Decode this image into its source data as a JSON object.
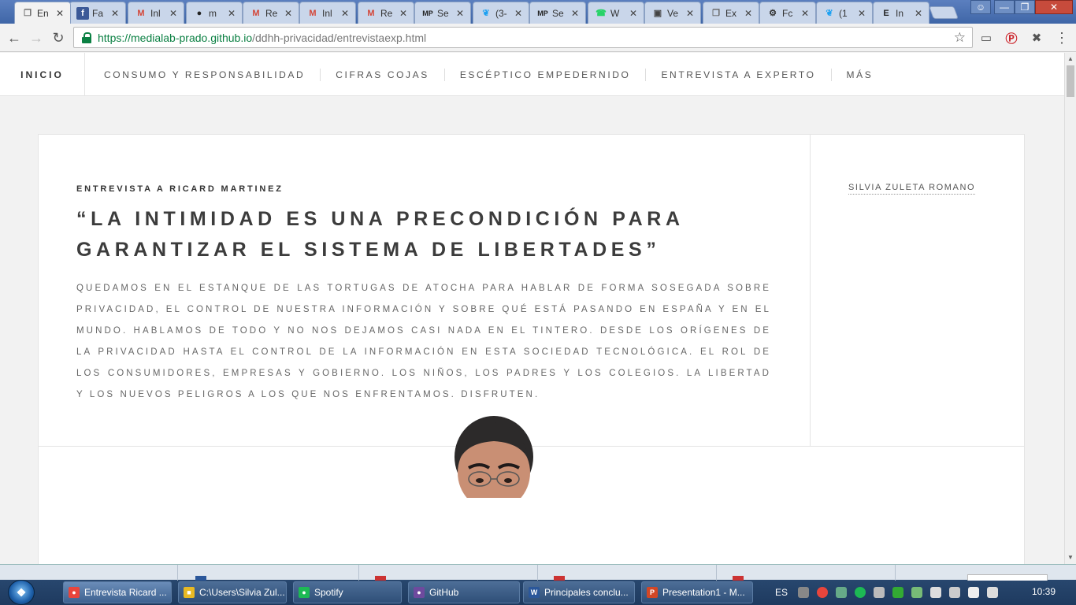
{
  "browser": {
    "tabs": [
      {
        "label": "En",
        "icon": "doc",
        "color": "#666",
        "active": true
      },
      {
        "label": "Fa",
        "icon": "f",
        "color": "#3b5998"
      },
      {
        "label": "Inl",
        "icon": "M",
        "color": "#d44638"
      },
      {
        "label": "m",
        "icon": "gh",
        "color": "#222"
      },
      {
        "label": "Re",
        "icon": "M",
        "color": "#d44638"
      },
      {
        "label": "Inl",
        "icon": "M",
        "color": "#d44638"
      },
      {
        "label": "Re",
        "icon": "M",
        "color": "#d44638"
      },
      {
        "label": "Se",
        "icon": "MP",
        "color": "#222"
      },
      {
        "label": "(3-",
        "icon": "tw",
        "color": "#1da1f2"
      },
      {
        "label": "Se",
        "icon": "MP",
        "color": "#222"
      },
      {
        "label": "W",
        "icon": "wa",
        "color": "#25d366"
      },
      {
        "label": "Ve",
        "icon": "vi",
        "color": "#444"
      },
      {
        "label": "Ex",
        "icon": "doc",
        "color": "#666"
      },
      {
        "label": "Fc",
        "icon": "gear",
        "color": "#333"
      },
      {
        "label": "(1",
        "icon": "tw",
        "color": "#1da1f2"
      },
      {
        "label": "In",
        "icon": "E",
        "color": "#222"
      }
    ],
    "url_host": "https://medialab-prado.github.io",
    "url_path": "/ddhh-privacidad/entrevistaexp.html"
  },
  "site": {
    "brand": "INICIO",
    "nav": [
      "CONSUMO Y RESPONSABILIDAD",
      "CIFRAS COJAS",
      "ESCÉPTICO EMPEDERNIDO",
      "ENTREVISTA A EXPERTO",
      "MÁS"
    ]
  },
  "article": {
    "kicker": "ENTREVISTA A RICARD MARTINEZ",
    "headline": "“LA INTIMIDAD ES UNA PRECONDICIÓN PARA GARANTIZAR EL SISTEMA DE LIBERTADES”",
    "lead": "QUEDAMOS EN EL ESTANQUE DE LAS TORTUGAS DE ATOCHA PARA HABLAR DE FORMA SOSEGADA SOBRE PRIVACIDAD, EL CONTROL DE NUESTRA INFORMACIÓN Y SOBRE QUÉ ESTÁ PASANDO EN ESPAÑA Y EN EL MUNDO. HABLAMOS DE TODO Y NO NOS DEJAMOS CASI NADA EN EL TINTERO. DESDE LOS ORÍGENES DE LA PRIVACIDAD HASTA EL CONTROL DE LA INFORMACIÓN EN ESTA SOCIEDAD TECNOLÓGICA. EL ROL DE LOS CONSUMIDORES, EMPRESAS Y GOBIERNO. LOS NIÑOS, LOS PADRES Y LOS COLEGIOS. LA LIBERTAD Y LOS NUEVOS PELIGROS A LOS QUE NOS ENFRENTAMOS. DISFRUTEN.",
    "author": "SILVIA ZULETA ROMANO"
  },
  "taskbar": {
    "buttons": [
      {
        "label": "Entrevista Ricard ...",
        "icon": "chrome",
        "color": "#e8453c"
      },
      {
        "label": "C:\\Users\\Silvia Zul...",
        "icon": "folder",
        "color": "#e8b923"
      },
      {
        "label": "Spotify",
        "icon": "spotify",
        "color": "#1db954"
      },
      {
        "label": "GitHub",
        "icon": "github",
        "color": "#6e4a9e"
      },
      {
        "label": "Principales conclu...",
        "icon": "word",
        "color": "#2b579a"
      },
      {
        "label": "Presentation1 - M...",
        "icon": "powerpoint",
        "color": "#d24726"
      }
    ],
    "lang": "ES",
    "clock": "10:39"
  }
}
